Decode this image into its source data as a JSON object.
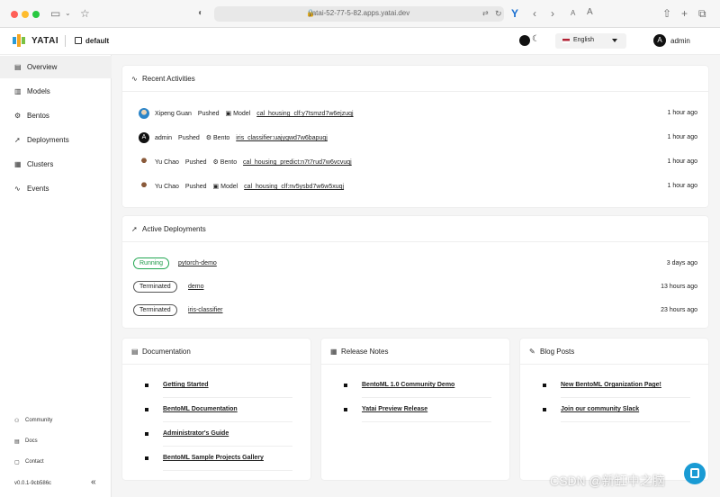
{
  "browser": {
    "url": "yatai-52-77-5-82.apps.yatai.dev",
    "aa_small": "A",
    "aa_large": "A"
  },
  "header": {
    "logo": "YATAI",
    "org": "default",
    "language": "English",
    "user_initial": "A",
    "user": "admin"
  },
  "sidebar": {
    "items": [
      {
        "label": "Overview",
        "icon": "overview-icon",
        "active": true
      },
      {
        "label": "Models",
        "icon": "model-icon"
      },
      {
        "label": "Bentos",
        "icon": "bento-icon"
      },
      {
        "label": "Deployments",
        "icon": "rocket-icon"
      },
      {
        "label": "Clusters",
        "icon": "cluster-icon"
      },
      {
        "label": "Events",
        "icon": "activity-icon"
      }
    ],
    "footer": [
      {
        "label": "Community"
      },
      {
        "label": "Docs"
      },
      {
        "label": "Contact"
      }
    ],
    "version": "v0.0.1-9cb586c"
  },
  "recent": {
    "title": "Recent Activities",
    "rows": [
      {
        "user": "Xipeng Guan",
        "action": "Pushed",
        "kind": "Model",
        "name": "cal_housing_clf:y7tsmzd7w6ejzuqj",
        "time": "1 hour ago"
      },
      {
        "user": "admin",
        "avatar_letter": "A",
        "action": "Pushed",
        "kind": "Bento",
        "name": "iris_classifier:uajygwd7w6bapuqj",
        "time": "1 hour ago"
      },
      {
        "user": "Yu Chao",
        "action": "Pushed",
        "kind": "Bento",
        "name": "cal_housing_predict:n7t7rud7w6vcvuqj",
        "time": "1 hour ago"
      },
      {
        "user": "Yu Chao",
        "action": "Pushed",
        "kind": "Model",
        "name": "cal_housing_clf:nv5ysbd7w6w5xuqj",
        "time": "1 hour ago"
      }
    ]
  },
  "deployments": {
    "title": "Active Deployments",
    "rows": [
      {
        "status": "Running",
        "name": "pytorch-demo",
        "time": "3 days ago"
      },
      {
        "status": "Terminated",
        "name": "demo",
        "time": "13 hours ago"
      },
      {
        "status": "Terminated",
        "name": "iris-classifier",
        "time": "23 hours ago"
      }
    ]
  },
  "documentation": {
    "title": "Documentation",
    "links": [
      "Getting Started",
      "BentoML Documentation",
      "Administrator's Guide",
      "BentoML Sample Projects Gallery"
    ]
  },
  "release_notes": {
    "title": "Release Notes",
    "links": [
      "BentoML 1.0 Community Demo",
      "Yatai Preview Release"
    ]
  },
  "blog": {
    "title": "Blog Posts",
    "links": [
      "New BentoML Organization Page!",
      "Join our community Slack"
    ]
  },
  "watermark": "CSDN @新缸中之脑",
  "colors": {
    "running": "#21a651",
    "help_button": "#1a9bd4",
    "active_nav": "#f0f0f0"
  }
}
